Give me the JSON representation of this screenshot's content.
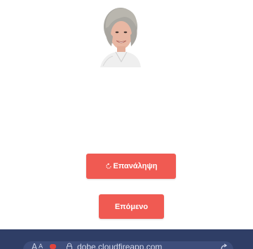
{
  "colors": {
    "button_bg": "#f05a52",
    "button_text": "#ffffff",
    "browser_bar_bg": "#2f3e66",
    "url_pill_bg": "#3d4d7a",
    "recording_dot": "#e0443d"
  },
  "portrait": {
    "icon": "person-photo"
  },
  "buttons": {
    "repeat_label": "Επανάληψη",
    "repeat_icon": "refresh-icon",
    "next_label": "Επόμενο"
  },
  "browser": {
    "back_glyph": "A",
    "url": "dobe.cloudfireapp.com",
    "lock_icon": "lock-icon",
    "share_icon": "share-icon"
  }
}
